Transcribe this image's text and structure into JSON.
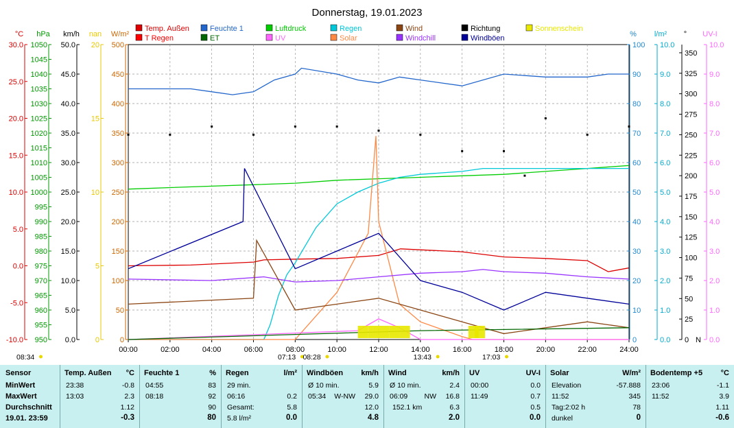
{
  "title": "Donnerstag, 19.01.2023",
  "legend": [
    {
      "label": "Temp. Außen",
      "color": "#dd0000"
    },
    {
      "label": "Feuchte 1",
      "color": "#2266cc"
    },
    {
      "label": "Luftdruck",
      "color": "#00cc00"
    },
    {
      "label": "Regen",
      "color": "#00c8d8"
    },
    {
      "label": "Wind",
      "color": "#8b4513"
    },
    {
      "label": "Richtung",
      "color": "#000000"
    },
    {
      "label": "Sonnenschein",
      "color": "#e8e800"
    },
    {
      "label": "T Regen",
      "color": "#ff0000"
    },
    {
      "label": "ET",
      "color": "#006600"
    },
    {
      "label": "UV",
      "color": "#ff66ff"
    },
    {
      "label": "Solar",
      "color": "#ff8844"
    },
    {
      "label": "Windchill",
      "color": "#9933ff"
    },
    {
      "label": "Windböen",
      "color": "#000099"
    }
  ],
  "chart_data": {
    "type": "line",
    "x_ticks": [
      "00:00",
      "02:00",
      "04:00",
      "06:00",
      "08:00",
      "10:00",
      "12:00",
      "14:00",
      "16:00",
      "18:00",
      "20:00",
      "22:00",
      "24:00"
    ],
    "left_axes": [
      {
        "unit": "°C",
        "color": "#dd0000",
        "ticks": [
          "30.0",
          "25.0",
          "20.0",
          "15.0",
          "10.0",
          "5.0",
          "0.0",
          "-5.0",
          "-10.0"
        ]
      },
      {
        "unit": "hPa",
        "color": "#009900",
        "ticks": [
          "1050",
          "1045",
          "1040",
          "1035",
          "1030",
          "1025",
          "1020",
          "1015",
          "1010",
          "1005",
          "1000",
          "995",
          "990",
          "985",
          "980",
          "975",
          "970",
          "965",
          "960",
          "955",
          "950"
        ]
      },
      {
        "unit": "km/h",
        "color": "#000000",
        "ticks": [
          "50.0",
          "45.0",
          "40.0",
          "35.0",
          "30.0",
          "25.0",
          "20.0",
          "15.0",
          "10.0",
          "5.0",
          "0.0"
        ]
      },
      {
        "unit": "nan",
        "color": "#e8c800",
        "ticks": [
          "20",
          "15",
          "10",
          "5",
          "0"
        ]
      },
      {
        "unit": "W/m²",
        "color": "#cc6600",
        "ticks": [
          "500",
          "450",
          "400",
          "350",
          "300",
          "250",
          "200",
          "150",
          "100",
          "50",
          "0"
        ]
      }
    ],
    "right_axes": [
      {
        "unit": "%",
        "color": "#2288cc",
        "ticks": [
          "100",
          "90",
          "80",
          "70",
          "60",
          "50",
          "40",
          "30",
          "20",
          "10",
          "0"
        ]
      },
      {
        "unit": "l/m²",
        "color": "#00aacc",
        "ticks": [
          "10.0",
          "9.0",
          "8.0",
          "7.0",
          "6.0",
          "5.0",
          "4.0",
          "3.0",
          "2.0",
          "1.0",
          "0.0"
        ]
      },
      {
        "unit": "°",
        "color": "#000000",
        "ticks": [
          "350",
          "325",
          "300",
          "275",
          "250",
          "225",
          "200",
          "175",
          "150",
          "125",
          "100",
          "75",
          "50",
          "25",
          "0"
        ]
      },
      {
        "unit": "UV-I",
        "color": "#ff66ff",
        "ticks": [
          "10.0",
          "9.0",
          "8.0",
          "7.0",
          "6.0",
          "5.0",
          "4.0",
          "3.0",
          "2.0",
          "1.0",
          "0.0"
        ]
      }
    ],
    "direction_zero_label": "N",
    "series": [
      {
        "name": "Temp. Außen",
        "axis": "°C",
        "x": [
          0,
          3,
          6,
          6.5,
          8,
          10,
          12,
          13.05,
          16,
          18,
          20,
          22,
          23,
          23.98
        ],
        "y": [
          0.0,
          0.1,
          0.5,
          0.8,
          0.9,
          1.0,
          1.4,
          2.3,
          1.9,
          1.2,
          1.0,
          0.7,
          -0.8,
          -0.3
        ]
      },
      {
        "name": "Feuchte 1",
        "axis": "%",
        "x": [
          0,
          1,
          2,
          3,
          4,
          5,
          6,
          7,
          8,
          8.3,
          10,
          11,
          12,
          13,
          14,
          16,
          18,
          20,
          22,
          23,
          24
        ],
        "y": [
          85,
          85,
          85,
          85,
          84,
          83,
          84,
          88,
          90,
          92,
          90,
          88,
          87,
          89,
          88,
          86,
          90,
          89,
          89,
          90,
          90
        ]
      },
      {
        "name": "Luftdruck",
        "axis": "hPa",
        "x": [
          0,
          2,
          4,
          6,
          8,
          10,
          12,
          14,
          16,
          18,
          20,
          22,
          24
        ],
        "y": [
          1001,
          1001.5,
          1002,
          1002.5,
          1003,
          1004,
          1004.5,
          1005,
          1005.5,
          1006,
          1007,
          1008,
          1009
        ]
      },
      {
        "name": "Regen",
        "axis": "l/m²",
        "x": [
          0,
          6.5,
          6.8,
          7.2,
          7.6,
          8,
          9,
          10,
          11,
          12,
          13,
          14,
          16,
          17,
          18,
          24
        ],
        "y": [
          0,
          0,
          0.5,
          1.5,
          2.2,
          2.6,
          3.8,
          4.6,
          5,
          5.3,
          5.5,
          5.6,
          5.7,
          5.8,
          5.8,
          5.8
        ]
      },
      {
        "name": "Solar",
        "axis": "W/m²",
        "x": [
          0,
          8,
          10,
          11.5,
          11.87,
          12,
          13,
          14,
          16,
          16.5,
          24
        ],
        "y": [
          0,
          0,
          80,
          180,
          345,
          200,
          60,
          30,
          5,
          0,
          0
        ]
      },
      {
        "name": "Windchill",
        "axis": "°C",
        "x": [
          0,
          4,
          6.5,
          8,
          10,
          12,
          14,
          16,
          17,
          18,
          20,
          22,
          24
        ],
        "y": [
          -1.8,
          -2.0,
          -1.5,
          -2.2,
          -2.0,
          -1.5,
          -1.0,
          -0.8,
          -0.5,
          -0.8,
          -1.0,
          -1.5,
          -1.8
        ]
      },
      {
        "name": "Wind",
        "axis": "km/h",
        "x": [
          0,
          6,
          6.15,
          8,
          10,
          12,
          14,
          16,
          18,
          20,
          22,
          24
        ],
        "y": [
          6,
          7,
          16.8,
          5,
          6,
          7,
          5,
          3,
          1,
          2,
          3,
          2
        ]
      },
      {
        "name": "Windböen",
        "axis": "km/h",
        "x": [
          0,
          5.5,
          5.57,
          8,
          10,
          12,
          14,
          16,
          18,
          20,
          22,
          24
        ],
        "y": [
          12,
          20,
          29,
          12,
          15,
          18,
          10,
          8,
          5,
          8,
          7,
          6
        ]
      },
      {
        "name": "Richtung",
        "axis": "°",
        "type": "scatter",
        "x": [
          0,
          2,
          4,
          6,
          8,
          10,
          12,
          14,
          16,
          18,
          19,
          20,
          22,
          24
        ],
        "y": [
          250,
          250,
          260,
          250,
          260,
          260,
          255,
          250,
          230,
          230,
          200,
          270,
          250,
          260
        ]
      },
      {
        "name": "UV",
        "axis": "UV-I",
        "x": [
          0,
          11,
          12,
          13,
          14,
          24
        ],
        "y": [
          0,
          0.3,
          0.7,
          0.4,
          0,
          0
        ]
      },
      {
        "name": "ET",
        "axis": "l/m²",
        "x": [
          0,
          14,
          24
        ],
        "y": [
          0,
          0.3,
          0.4
        ]
      },
      {
        "name": "Sonnenschein",
        "axis": "nan",
        "type": "bar",
        "x": [
          11,
          11.5,
          12,
          12.5,
          13,
          16.3,
          16.6
        ],
        "y": [
          1,
          1,
          1,
          1,
          1,
          1,
          1
        ]
      }
    ],
    "bottom_markers": [
      {
        "label": "08:34",
        "x": -0.5
      },
      {
        "label": "07:13",
        "x": 7.1
      },
      {
        "label": "08:28",
        "x": 8.3
      },
      {
        "label": "13:43",
        "x": 13.6
      },
      {
        "label": "17:03",
        "x": 16.9
      }
    ],
    "grid": true
  },
  "table": {
    "row_labels": [
      "Sensor",
      "MinWert",
      "MaxWert",
      "Durchschnitt",
      "19.01. 23:59"
    ],
    "sections": [
      {
        "head": "Temp. Außen",
        "unit": "°C",
        "rows": [
          [
            "23:38",
            "",
            "-0.8"
          ],
          [
            "13:03",
            "",
            "2.3"
          ],
          [
            "",
            "",
            "1.12"
          ],
          [
            "",
            "",
            "-0.3"
          ]
        ]
      },
      {
        "head": "Feuchte 1",
        "unit": "%",
        "rows": [
          [
            "04:55",
            "",
            "83"
          ],
          [
            "08:18",
            "",
            "92"
          ],
          [
            "",
            "",
            "90"
          ],
          [
            "",
            "",
            "80"
          ]
        ]
      },
      {
        "head": "Regen",
        "unit": "l/m²",
        "rows": [
          [
            "29 min.",
            "",
            ""
          ],
          [
            "06:16",
            "",
            "0.2"
          ],
          [
            "Gesamt:",
            "",
            "5.8"
          ],
          [
            "5.8 l/m²",
            "",
            "0.0"
          ]
        ]
      },
      {
        "head": "Windböen",
        "unit": "km/h",
        "rows": [
          [
            "Ø 10 min.",
            "",
            "5.9"
          ],
          [
            "05:34",
            "W-NW",
            "29.0"
          ],
          [
            "",
            "",
            "12.0"
          ],
          [
            "",
            "",
            "4.8"
          ]
        ]
      },
      {
        "head": "Wind",
        "unit": "km/h",
        "rows": [
          [
            "Ø 10 min.",
            "",
            "2.4"
          ],
          [
            "06:09",
            "NW",
            "16.8"
          ],
          [
            "152.1 km",
            "",
            "6.3"
          ],
          [
            "",
            "",
            "2.0"
          ]
        ]
      },
      {
        "head": "UV",
        "unit": "UV-I",
        "rows": [
          [
            "00:00",
            "",
            "0.0"
          ],
          [
            "11:49",
            "",
            "0.7"
          ],
          [
            "",
            "",
            "0.5"
          ],
          [
            "",
            "",
            "0.0"
          ]
        ]
      },
      {
        "head": "Solar",
        "unit": "W/m²",
        "rows": [
          [
            "Elevation",
            "",
            "-57.888"
          ],
          [
            "11:52",
            "",
            "345"
          ],
          [
            "Tag:2:02 h",
            "",
            "78"
          ],
          [
            "dunkel",
            "",
            "0"
          ]
        ]
      },
      {
        "head": "Bodentemp +5",
        "unit": "°C",
        "rows": [
          [
            "23:06",
            "",
            "-1.1"
          ],
          [
            "11:52",
            "",
            "3.9"
          ],
          [
            "",
            "",
            "1.11"
          ],
          [
            "",
            "",
            "-0.6"
          ]
        ]
      }
    ]
  }
}
